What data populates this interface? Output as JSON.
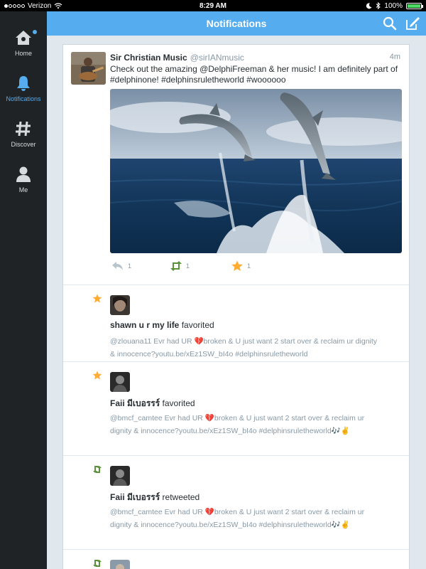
{
  "status_bar": {
    "carrier": "Verizon",
    "time": "8:29 AM",
    "battery_text": "100%",
    "battery_level": 1.0,
    "battery_color": "#4cd964"
  },
  "sidebar": {
    "items": [
      {
        "label": "Home",
        "icon": "home-icon",
        "active": false,
        "unread_dot": true
      },
      {
        "label": "Notifications",
        "icon": "bell-icon",
        "active": true
      },
      {
        "label": "Discover",
        "icon": "hashtag-icon",
        "active": false
      },
      {
        "label": "Me",
        "icon": "person-icon",
        "active": false
      }
    ]
  },
  "header": {
    "title": "Notifications",
    "icons": [
      "search-icon",
      "compose-icon"
    ],
    "accent": "#55acee"
  },
  "tweet": {
    "name": "Sir Christian Music",
    "handle": "@sirIANmusic",
    "time": "4m",
    "text": "Check out the amazing @DelphiFreeman & her music! I am definitely part of #delphinone! #delphinsruletheworld #woooooo",
    "media_icon": "dolphins-photo",
    "reply_count": "1",
    "retweet_count": "1",
    "favorite_count": "1"
  },
  "notifications": [
    {
      "type": "favorite",
      "icon": "star-icon",
      "name": "shawn u r my life",
      "action": "favorited",
      "tweet": "@zlouana11 Evr had UR 💔broken & U just want 2 start over & reclaim ur dignity & innocence?youtu.be/xEz1SW_bI4o #delphinsruletheworld"
    },
    {
      "type": "favorite",
      "icon": "star-icon",
      "name": "Faii มีเบอรรร์",
      "action": "favorited",
      "tweet": "@bmcf_camtee Evr had UR 💔broken & U just want 2 start over & reclaim ur dignity & innocence?youtu.be/xEz1SW_bI4o #delphinsruletheworld🎶✌"
    },
    {
      "type": "retweet",
      "icon": "retweet-icon",
      "name": "Faii มีเบอรรร์",
      "action": "retweeted",
      "tweet": "@bmcf_camtee Evr had UR 💔broken & U just want 2 start over & reclaim ur dignity & innocence?youtu.be/xEz1SW_bI4o #delphinsruletheworld🎶✌"
    },
    {
      "type": "retweet",
      "icon": "retweet-icon"
    }
  ],
  "colors": {
    "favorite": "#ffac33",
    "retweet": "#5c913b",
    "muted": "#8899a6"
  }
}
